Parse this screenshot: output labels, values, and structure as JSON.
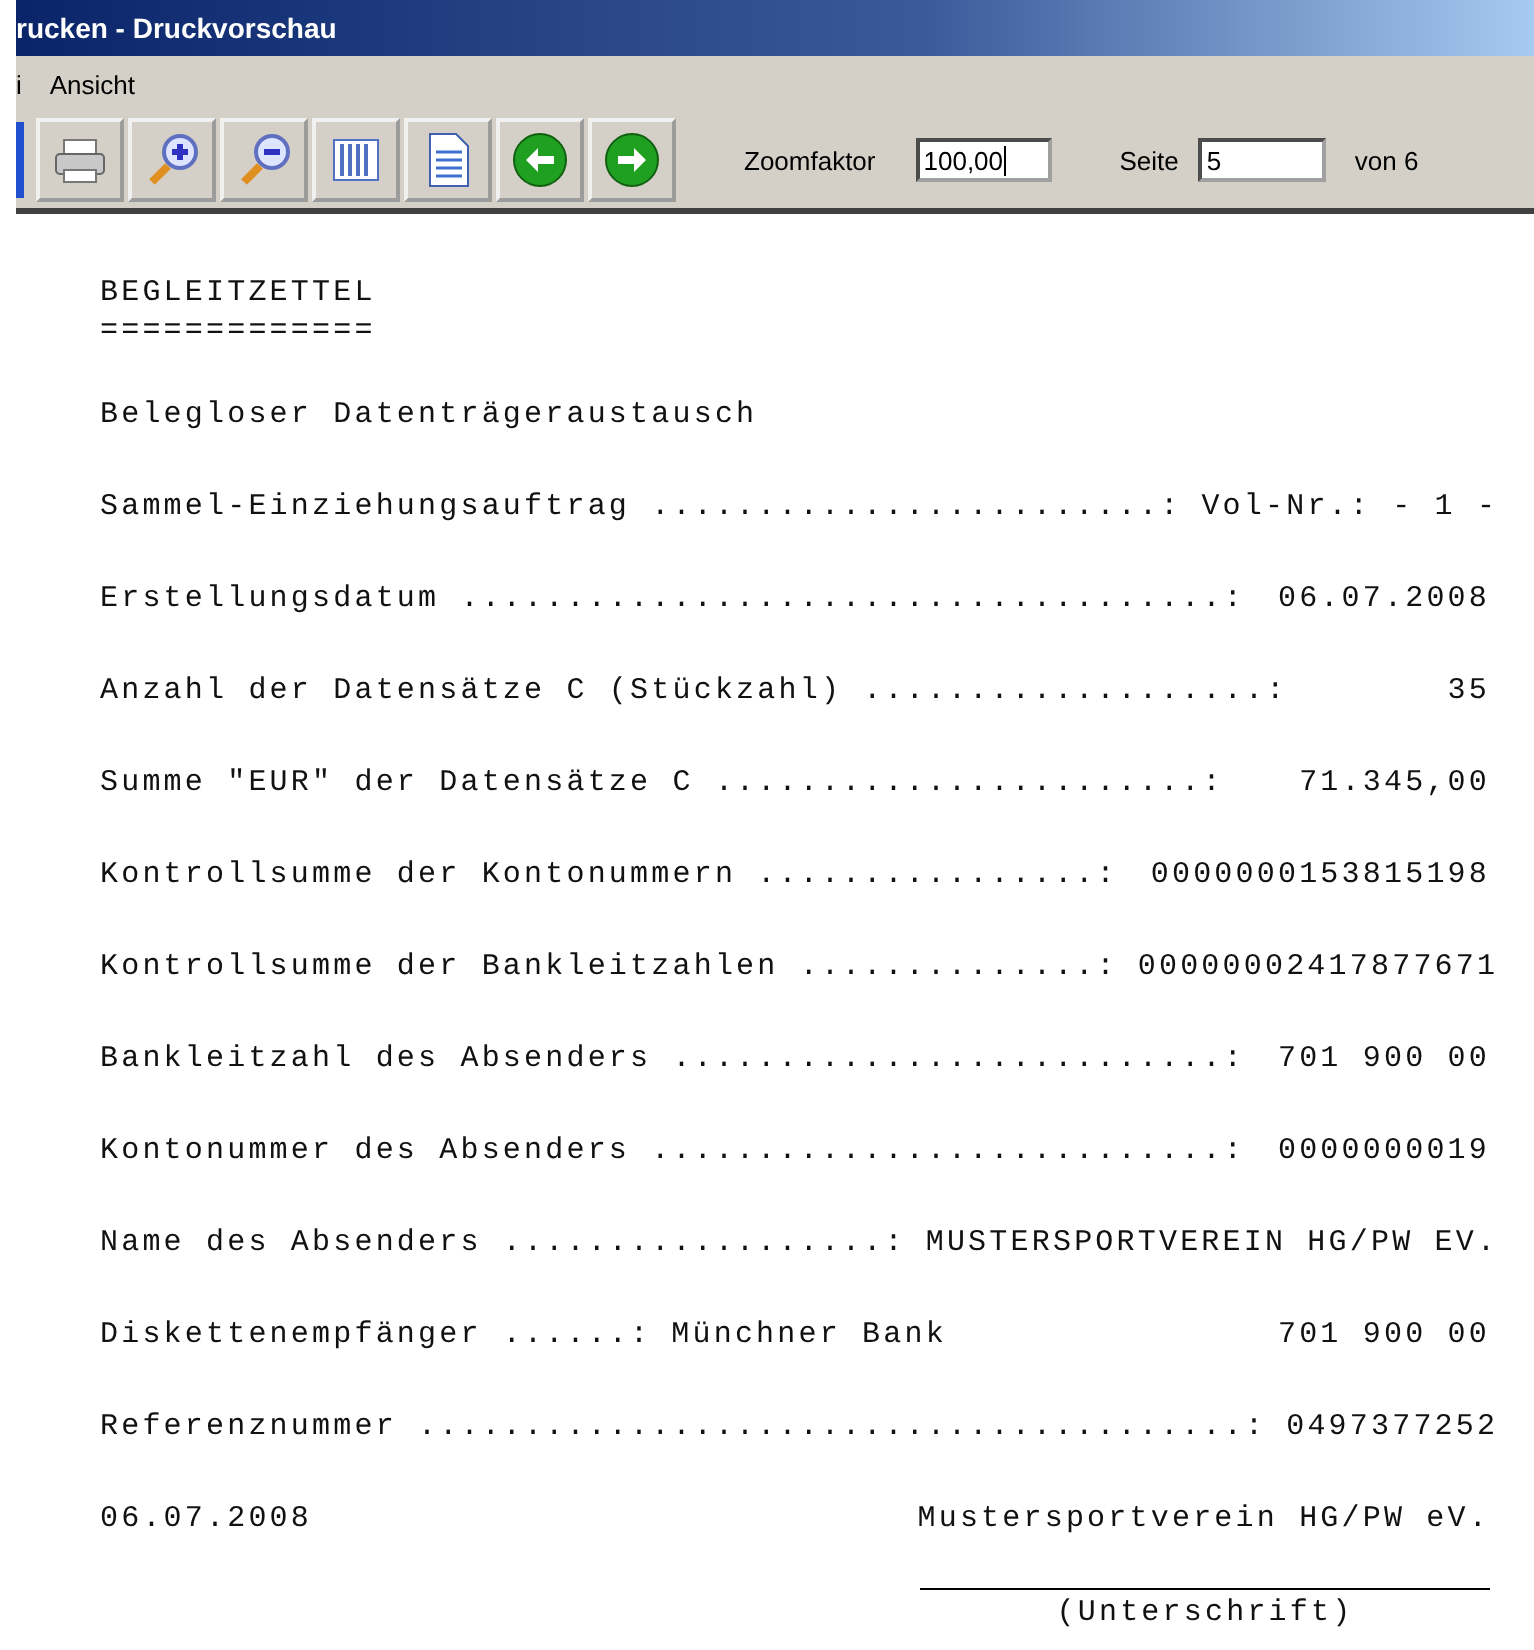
{
  "window": {
    "title": "rucken - Druckvorschau"
  },
  "menu": [
    "i",
    "Ansicht"
  ],
  "toolbar": {
    "buttons": [
      {
        "kind": "partial"
      },
      {
        "kind": "print"
      },
      {
        "kind": "zoom-in"
      },
      {
        "kind": "zoom-out"
      },
      {
        "kind": "columns"
      },
      {
        "kind": "page"
      },
      {
        "kind": "back"
      },
      {
        "kind": "forward"
      }
    ],
    "zoom_label": "Zoomfaktor",
    "zoom_value": "100,00",
    "page_label": "Seite",
    "page_value": "5",
    "page_total": "von 6"
  },
  "document": {
    "title": "BEGLEITZETTEL",
    "underline": "=============",
    "subtitle": "Belegloser Datenträgeraustausch",
    "rows": [
      {
        "label": "Sammel-Einziehungsauftrag ........................:",
        "value": "Vol-Nr.: - 1 -"
      },
      {
        "label": "Erstellungsdatum ....................................:",
        "value": "06.07.2008"
      },
      {
        "label": "Anzahl der Datensätze C (Stückzahl) ...................:",
        "value": "35"
      },
      {
        "label": "Summe \"EUR\" der Datensätze C .......................:",
        "value": "71.345,00"
      },
      {
        "label": "Kontrollsumme der Kontonummern ................:",
        "value": "0000000153815198"
      },
      {
        "label": "Kontrollsumme der Bankleitzahlen ..............:",
        "value": "00000002417877671"
      },
      {
        "label": "Bankleitzahl des Absenders ..........................:",
        "value": "701 900 00"
      },
      {
        "label": "Kontonummer des Absenders ...........................:",
        "value": "0000000019"
      },
      {
        "label": "Name des Absenders ..................:",
        "value": "MUSTERSPORTVEREIN HG/PW EV."
      },
      {
        "label": "Diskettenempfänger ......:",
        "note": "Münchner Bank",
        "value": "701 900 00"
      },
      {
        "label": "Referenznummer .......................................:",
        "value": "0497377252"
      },
      {
        "label": "06.07.2008",
        "value": "Mustersportverein HG/PW eV."
      }
    ],
    "signature": "(Unterschrift)"
  }
}
